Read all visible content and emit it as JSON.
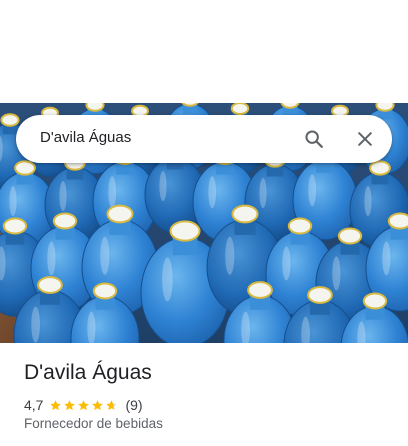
{
  "search": {
    "query": "D'avila Águas",
    "search_icon": "search-icon",
    "close_icon": "close-icon"
  },
  "hero": {
    "image": "photo of stacked blue water gallon jugs with white and yellow caps"
  },
  "place": {
    "name": "D'avila Águas",
    "rating": "4,7",
    "rating_value": 4.7,
    "stars_total": 5,
    "review_count": "(9)",
    "category": "Fornecedor de bebidas"
  },
  "colors": {
    "star": "#fbbc04",
    "star_empty": "#dadce0",
    "icon": "#5f6368",
    "text_primary": "#202124",
    "text_secondary": "#5f6368"
  }
}
